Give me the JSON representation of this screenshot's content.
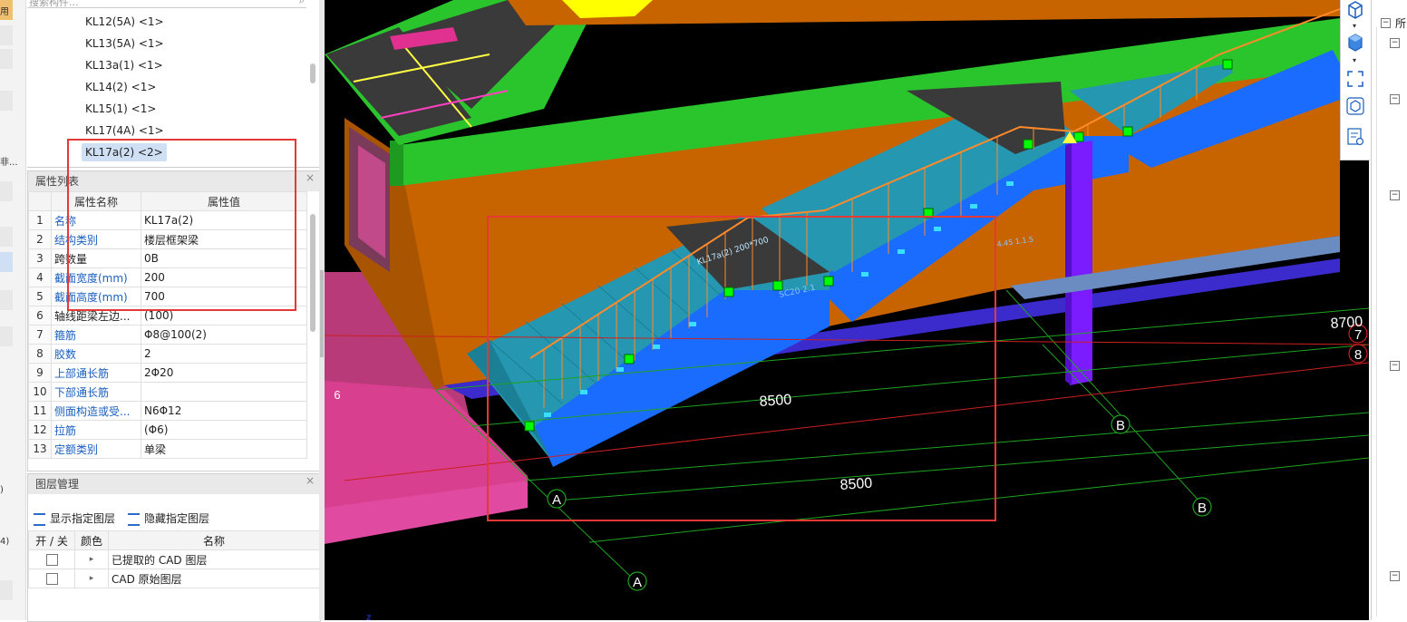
{
  "left_strip": {
    "label_top": "用",
    "label_mid": "非...",
    "label_low1": ")",
    "label_low2": "4)"
  },
  "tree": {
    "search_placeholder": "搜索构件...",
    "items": [
      {
        "label": "KL12(5A) <1>",
        "selected": false
      },
      {
        "label": "KL13(5A) <1>",
        "selected": false
      },
      {
        "label": "KL13a(1) <1>",
        "selected": false
      },
      {
        "label": "KL14(2) <1>",
        "selected": false
      },
      {
        "label": "KL15(1) <1>",
        "selected": false
      },
      {
        "label": "KL17(4A) <1>",
        "selected": false
      },
      {
        "label": "KL17a(2) <2>",
        "selected": true
      }
    ]
  },
  "properties": {
    "title": "属性列表",
    "close": "×",
    "col_name": "属性名称",
    "col_value": "属性值",
    "rows": [
      {
        "n": "1",
        "name": "名称",
        "value": "KL17a(2)",
        "blue": true
      },
      {
        "n": "2",
        "name": "结构类别",
        "value": "楼层框架梁",
        "blue": true
      },
      {
        "n": "3",
        "name": "跨数量",
        "value": "0B",
        "blue": false
      },
      {
        "n": "4",
        "name": "截面宽度(mm)",
        "value": "200",
        "blue": true
      },
      {
        "n": "5",
        "name": "截面高度(mm)",
        "value": "700",
        "blue": true
      },
      {
        "n": "6",
        "name": "轴线距梁左边...",
        "value": "(100)",
        "blue": false
      },
      {
        "n": "7",
        "name": "箍筋",
        "value": "Φ8@100(2)",
        "blue": true
      },
      {
        "n": "8",
        "name": "胶数",
        "value": "2",
        "blue": true
      },
      {
        "n": "9",
        "name": "上部通长筋",
        "value": "2Φ20",
        "blue": true
      },
      {
        "n": "10",
        "name": "下部通长筋",
        "value": "",
        "blue": true
      },
      {
        "n": "11",
        "name": "侧面构造或受...",
        "value": "N6Φ12",
        "blue": true
      },
      {
        "n": "12",
        "name": "拉筋",
        "value": "(Φ6)",
        "blue": true
      },
      {
        "n": "13",
        "name": "定额类别",
        "value": "单梁",
        "blue": true
      }
    ]
  },
  "layers": {
    "title": "图层管理",
    "close": "×",
    "show_btn": "显示指定图层",
    "hide_btn": "隐藏指定图层",
    "col_onoff": "开 / 关",
    "col_color": "颜色",
    "col_name": "名称",
    "rows": [
      {
        "name": "已提取的 CAD 图层",
        "checked": false
      },
      {
        "name": "CAD 原始图层",
        "checked": false
      }
    ]
  },
  "viewport": {
    "dimensions": [
      "8500",
      "8500",
      "8700"
    ],
    "axis_labels": [
      "A",
      "A",
      "B",
      "B",
      "6",
      "7",
      "8"
    ],
    "beam_annotation": "KL17a(2) 200*700",
    "slab_annotation": "SC20 2.1",
    "step_annotation": "4.45 1.1.5"
  },
  "right_panel": {
    "header": "所"
  },
  "colors": {
    "wall_orange": "#c86400",
    "beam_green": "#2ac52c",
    "stair_blue": "#1a6cff",
    "stair_teal": "#2597b0",
    "column_purple": "#7a1cff",
    "railing_orange": "#ff8a2a",
    "highlight_red": "#e53935",
    "axis_green": "#1fa31f",
    "slab_pink": "#d8408f"
  }
}
